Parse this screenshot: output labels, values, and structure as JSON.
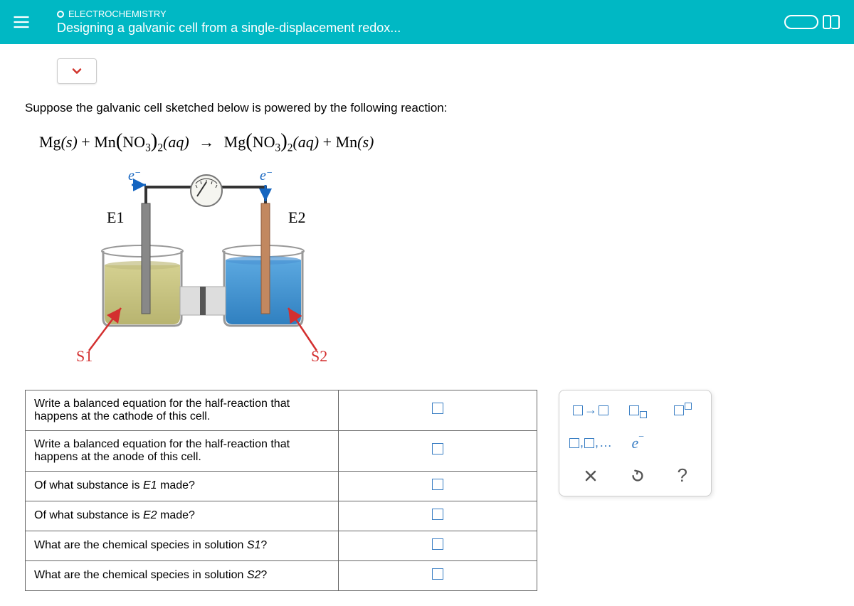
{
  "header": {
    "topic": "ELECTROCHEMISTRY",
    "title": "Designing a galvanic cell from a single-displacement redox..."
  },
  "prompt": "Suppose the galvanic cell sketched below is powered by the following reaction:",
  "equation": {
    "lhs_a": "Mg",
    "lhs_a_phase": "(s)",
    "plus1": "+",
    "lhs_b_core": "Mn",
    "lhs_b_anion": "NO",
    "lhs_b_anion_sub": "3",
    "lhs_b_outer_sub": "2",
    "lhs_b_phase": "(aq)",
    "arrow": "→",
    "rhs_a_core": "Mg",
    "rhs_a_anion": "NO",
    "rhs_a_anion_sub": "3",
    "rhs_a_outer_sub": "2",
    "rhs_a_phase": "(aq)",
    "plus2": "+",
    "rhs_b": "Mn",
    "rhs_b_phase": "(s)"
  },
  "diagram": {
    "e_left": "e",
    "e_right": "e",
    "label_e1": "E1",
    "label_e2": "E2",
    "label_s1": "S1",
    "label_s2": "S2"
  },
  "questions": [
    "Write a balanced equation for the half-reaction that happens at the cathode of this cell.",
    "Write a balanced equation for the half-reaction that happens at the anode of this cell.",
    "Of what substance is E1 made?",
    "Of what substance is E2 made?",
    "What are the chemical species in solution S1?",
    "What are the chemical species in solution S2?"
  ],
  "palette": {
    "list_label": "…",
    "e_label": "e",
    "help": "?"
  }
}
